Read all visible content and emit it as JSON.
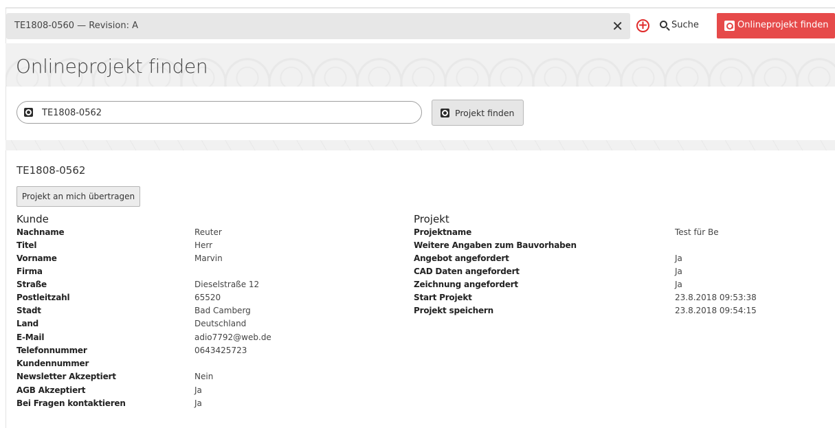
{
  "topbar": {
    "revision_text": "TE1808-0560 — Revision: A",
    "close_glyph": "✕",
    "add_glyph": "+",
    "search_label": "Suche",
    "find_button_label": "Onlineprojekt finden"
  },
  "header": {
    "title": "Onlineprojekt finden"
  },
  "search": {
    "value": "TE1808-0562",
    "button_label": "Projekt finden"
  },
  "project": {
    "id": "TE1808-0562",
    "transfer_button_label": "Projekt an mich übertragen"
  },
  "kunde": {
    "title": "Kunde",
    "rows": [
      {
        "label": "Nachname",
        "value": "Reuter"
      },
      {
        "label": "Titel",
        "value": "Herr"
      },
      {
        "label": "Vorname",
        "value": "Marvin"
      },
      {
        "label": "Firma",
        "value": ""
      },
      {
        "label": "Straße",
        "value": "Dieselstraße 12"
      },
      {
        "label": "Postleitzahl",
        "value": "65520"
      },
      {
        "label": "Stadt",
        "value": "Bad Camberg"
      },
      {
        "label": "Land",
        "value": "Deutschland"
      },
      {
        "label": "E-Mail",
        "value": "adio7792@web.de"
      },
      {
        "label": "Telefonnummer",
        "value": "0643425723"
      },
      {
        "label": "Kundennummer",
        "value": ""
      },
      {
        "label": "Newsletter Akzeptiert",
        "value": "Nein"
      },
      {
        "label": "AGB Akzeptiert",
        "value": "Ja"
      },
      {
        "label": "Bei Fragen kontaktieren",
        "value": "Ja"
      }
    ]
  },
  "projekt": {
    "title": "Projekt",
    "rows": [
      {
        "label": "Projektname",
        "value": "Test für Be"
      },
      {
        "label": "Weitere Angaben zum Bauvorhaben",
        "value": ""
      },
      {
        "label": "Angebot angefordert",
        "value": "Ja"
      },
      {
        "label": "CAD Daten angefordert",
        "value": "Ja"
      },
      {
        "label": "Zeichnung angefordert",
        "value": "Ja"
      },
      {
        "label": "Start Projekt",
        "value": "23.8.2018 09:53:38"
      },
      {
        "label": "Projekt speichern",
        "value": "23.8.2018 09:54:15"
      }
    ]
  },
  "colors": {
    "accent": "#e64a4a",
    "add_icon": "#e02a2a"
  },
  "icons": {
    "close": "close-icon",
    "add": "add-circle-icon",
    "search": "search-icon",
    "find": "find-project-icon"
  }
}
